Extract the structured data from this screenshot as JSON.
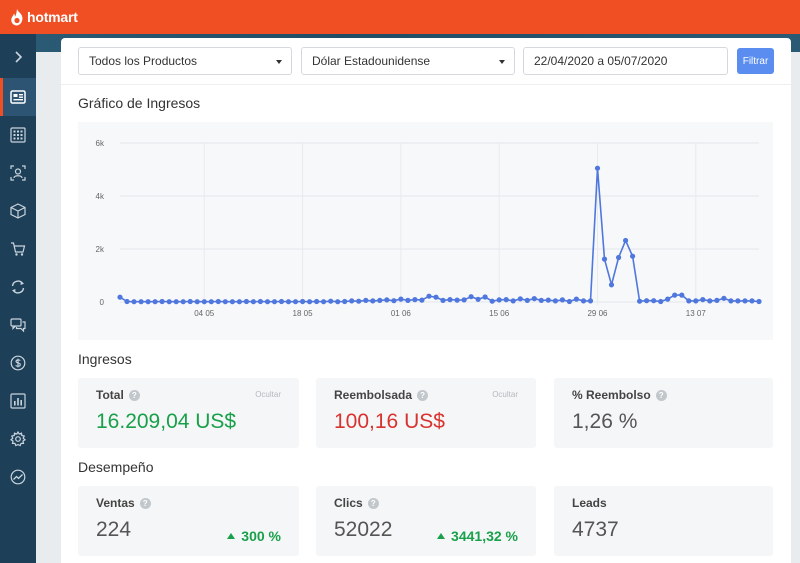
{
  "brand": {
    "name": "hotmart"
  },
  "sidebar": {
    "items": [
      {
        "icon": "chevron-right-icon"
      },
      {
        "icon": "dashboard-icon",
        "active": true
      },
      {
        "icon": "grid-icon"
      },
      {
        "icon": "affiliate-icon"
      },
      {
        "icon": "box-icon"
      },
      {
        "icon": "cart-icon"
      },
      {
        "icon": "refresh-icon"
      },
      {
        "icon": "chat-icon"
      },
      {
        "icon": "dollar-icon"
      },
      {
        "icon": "bar-chart-icon"
      },
      {
        "icon": "gear-icon"
      },
      {
        "icon": "trend-icon"
      }
    ]
  },
  "filters": {
    "product": "Todos los Productos",
    "currency": "Dólar Estadounidense",
    "date_range": "22/04/2020 a 05/07/2020",
    "filter_button": "Filtrar"
  },
  "chart": {
    "title": "Gráfico de Ingresos"
  },
  "chart_data": {
    "type": "line",
    "ylim": [
      0,
      6000
    ],
    "yticks": [
      "0",
      "2k",
      "4k",
      "6k"
    ],
    "xticks": [
      {
        "label": "04 05",
        "index": 12
      },
      {
        "label": "18 05",
        "index": 26
      },
      {
        "label": "01 06",
        "index": 40
      },
      {
        "label": "15 06",
        "index": 54
      },
      {
        "label": "29 06",
        "index": 68
      },
      {
        "label": "13 07",
        "index": 82
      }
    ],
    "grid": true,
    "series": [
      {
        "color": "#4f77dd",
        "values": [
          180,
          20,
          10,
          10,
          10,
          10,
          20,
          10,
          10,
          10,
          20,
          10,
          10,
          10,
          20,
          10,
          10,
          10,
          20,
          10,
          20,
          10,
          10,
          20,
          10,
          10,
          20,
          10,
          20,
          10,
          30,
          10,
          20,
          40,
          30,
          60,
          40,
          60,
          80,
          50,
          110,
          60,
          90,
          70,
          220,
          180,
          60,
          90,
          70,
          80,
          200,
          100,
          190,
          30,
          80,
          90,
          40,
          120,
          60,
          130,
          60,
          70,
          40,
          80,
          20,
          110,
          40,
          40,
          5050,
          1620,
          650,
          1680,
          2320,
          1730,
          30,
          50,
          50,
          20,
          110,
          260,
          260,
          40,
          40,
          90,
          40,
          60,
          140,
          40,
          40,
          40,
          40,
          20
        ]
      }
    ]
  },
  "ingresos": {
    "title": "Ingresos",
    "cards": [
      {
        "label": "Total",
        "value": "16.209,04 US$",
        "hide": "Ocultar"
      },
      {
        "label": "Reembolsada",
        "value": "100,16 US$",
        "hide": "Ocultar"
      },
      {
        "label": "% Reembolso",
        "value": "1,26 %"
      }
    ]
  },
  "desempeno": {
    "title": "Desempeño",
    "cards": [
      {
        "label": "Ventas",
        "value": "224",
        "delta": "300 %"
      },
      {
        "label": "Clics",
        "value": "52022",
        "delta": "3441,32 %"
      },
      {
        "label": "Leads",
        "value": "4737"
      }
    ]
  },
  "help_glyph": "?",
  "colors": {
    "brand": "#f04e23",
    "sidebar": "#1e3f58",
    "accent": "#5a8def",
    "positive": "#19a04b",
    "negative": "#d8332f"
  }
}
